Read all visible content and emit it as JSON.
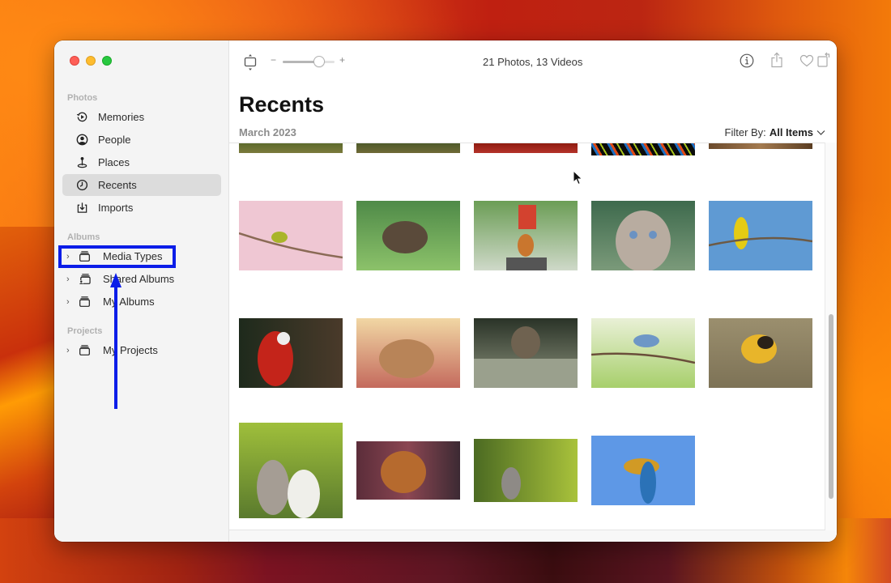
{
  "window": {
    "traffic_lights": [
      "close",
      "minimize",
      "zoom"
    ]
  },
  "sidebar": {
    "sections": [
      {
        "label": "Photos",
        "items": [
          {
            "label": "Memories",
            "icon": "memories-icon"
          },
          {
            "label": "People",
            "icon": "people-icon"
          },
          {
            "label": "Places",
            "icon": "places-icon"
          },
          {
            "label": "Recents",
            "icon": "recents-icon",
            "selected": true
          },
          {
            "label": "Imports",
            "icon": "imports-icon"
          }
        ]
      },
      {
        "label": "Albums",
        "items": [
          {
            "label": "Media Types",
            "icon": "album-stack-icon",
            "expandable": true,
            "highlighted": true
          },
          {
            "label": "Shared Albums",
            "icon": "shared-album-icon",
            "expandable": true
          },
          {
            "label": "My Albums",
            "icon": "album-stack-icon",
            "expandable": true
          }
        ]
      },
      {
        "label": "Projects",
        "items": [
          {
            "label": "My Projects",
            "icon": "album-stack-icon",
            "expandable": true
          }
        ]
      }
    ]
  },
  "toolbar": {
    "zoom_minus": "−",
    "zoom_plus": "+",
    "zoom_level": 0.7,
    "count_label": "21 Photos, 13 Videos",
    "icons": [
      "info-icon",
      "share-icon",
      "favorite-heart-icon",
      "rotate-icon",
      "search-icon"
    ]
  },
  "main": {
    "title": "Recents",
    "date_label": "March 2023",
    "filter_prefix": "Filter By:",
    "filter_value": "All Items",
    "scroll_position": 0.62
  },
  "photos": {
    "partial_row": [
      "grass",
      "grass-dark",
      "red-foliage",
      "colorful-mosaic",
      "brown-blur"
    ],
    "rows": [
      [
        "White-eye bird on blossom branch",
        "Hedgehog in grass",
        "Corgi on rail tracks",
        "Tabby cat with blue eyes",
        "Yellow canary on branch"
      ],
      [
        "Scarlet macaw",
        "French bulldog lying down",
        "Tabby cat in grass",
        "Nuthatch on flowering branch",
        "Duckling in water"
      ],
      [
        "Two kittens",
        "Puppy on checkered blanket",
        "Kitten in green grass",
        "Blue-and-gold macaw flying"
      ]
    ]
  },
  "annotation": {
    "color": "#0b1de8",
    "target": "Media Types"
  }
}
